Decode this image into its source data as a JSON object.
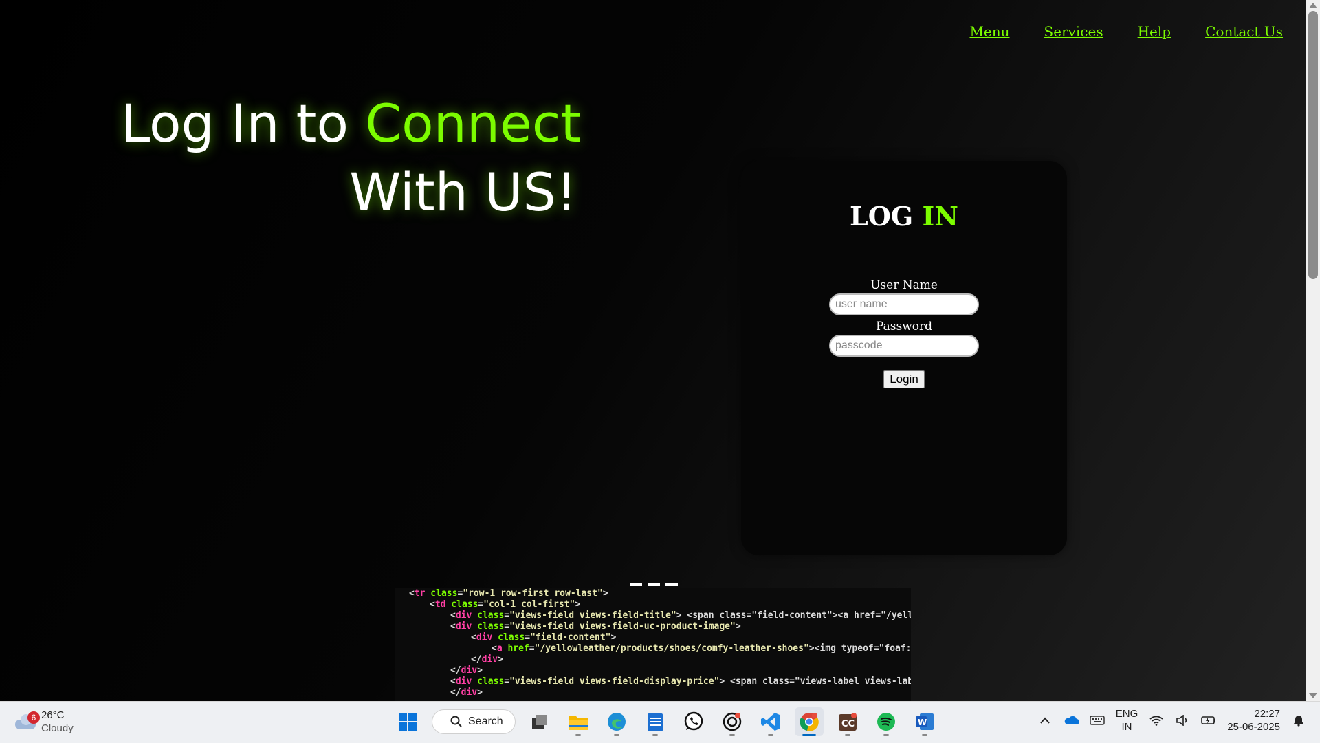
{
  "nav": {
    "items": [
      {
        "label": "Menu"
      },
      {
        "label": "Services"
      },
      {
        "label": "Help"
      },
      {
        "label": "Contact Us"
      }
    ]
  },
  "hero": {
    "line1_white": "Log In to ",
    "line1_green": "Connect",
    "line2": "With US!"
  },
  "login": {
    "title_white": "LOG ",
    "title_green": "IN",
    "username_label": "User Name",
    "username_placeholder": "user name",
    "password_label": "Password",
    "password_placeholder": "passcode",
    "submit_label": "Login"
  },
  "code_image": {
    "lines": [
      [
        "<",
        "tr",
        " class",
        "=",
        "\"row-1 row-first row-last\"",
        ">"
      ],
      [
        "<",
        "td",
        " class",
        "=",
        "\"col-1 col-first\"",
        ">"
      ],
      [
        "<",
        "div",
        " class",
        "=",
        "\"views-field views-field-title\"",
        "> <span class=\"field-content\"><a href=\"/yellowleather/products/co"
      ],
      [
        "<",
        "div",
        " class",
        "=",
        "\"views-field views-field-uc-product-image\"",
        ">"
      ],
      [
        "<",
        "div",
        " class",
        "=",
        "\"field-content\"",
        ">"
      ],
      [
        "<",
        "a",
        " href",
        "=",
        "\"/yellowleather/products/shoes/comfy-leather-shoes\"",
        "><img typeof=\"foaf:Image\" src=\"http://loc"
      ],
      [
        "</",
        "div",
        "",
        "",
        "",
        ">"
      ],
      [
        "</",
        "div",
        "",
        "",
        "",
        ">"
      ],
      [
        "<",
        "div",
        " class",
        "=",
        "\"views-field views-field-display-price\"",
        "> <span class=\"views-label views-label-display-pri"
      ],
      [
        "</",
        "div",
        "",
        "",
        "",
        ">"
      ]
    ]
  },
  "taskbar": {
    "weather_temp": "26°C",
    "weather_desc": "Cloudy",
    "weather_badge": "6",
    "search_label": "Search",
    "lang_line1": "ENG",
    "lang_line2": "IN",
    "time": "22:27",
    "date": "25-06-2025",
    "accent": "#0067c0"
  },
  "colors": {
    "accent_green": "#7cfc00",
    "card_bg": "#060606"
  }
}
